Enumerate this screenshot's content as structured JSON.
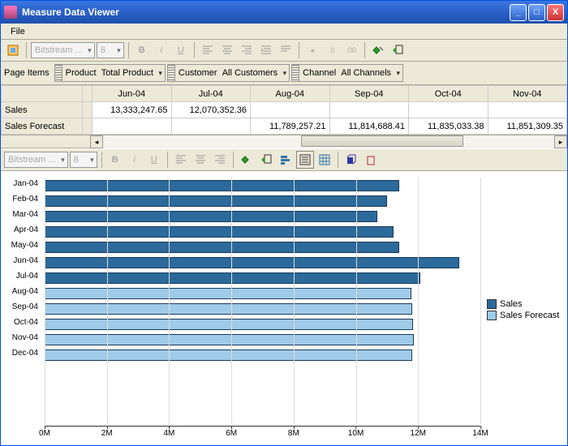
{
  "title": "Measure Data Viewer",
  "menu": {
    "file": "File"
  },
  "toolbar": {
    "font_name": "Bitstream ...",
    "font_size": "8"
  },
  "page_items": {
    "label": "Page Items",
    "dims": [
      {
        "name": "Product",
        "value": "Total Product"
      },
      {
        "name": "Customer",
        "value": "All Customers"
      },
      {
        "name": "Channel",
        "value": "All Channels"
      }
    ]
  },
  "grid": {
    "columns": [
      "Jun-04",
      "Jul-04",
      "Aug-04",
      "Sep-04",
      "Oct-04",
      "Nov-04"
    ],
    "rows": [
      {
        "label": "Sales",
        "cells": [
          "13,333,247.65",
          "12,070,352.36",
          "",
          "",
          "",
          ""
        ]
      },
      {
        "label": "Sales Forecast",
        "cells": [
          "",
          "",
          "11,789,257.21",
          "11,814,688.41",
          "11,835,033.38",
          "11,851,309.35"
        ]
      }
    ]
  },
  "legend": {
    "sales": "Sales",
    "forecast": "Sales Forecast"
  },
  "chart_data": {
    "type": "bar",
    "orientation": "horizontal",
    "categories": [
      "Jan-04",
      "Feb-04",
      "Mar-04",
      "Apr-04",
      "May-04",
      "Jun-04",
      "Jul-04",
      "Aug-04",
      "Sep-04",
      "Oct-04",
      "Nov-04",
      "Dec-04"
    ],
    "series": [
      {
        "name": "Sales",
        "values": [
          11400000,
          11000000,
          10700000,
          11200000,
          11400000,
          13333248,
          12070352,
          null,
          null,
          null,
          null,
          null
        ]
      },
      {
        "name": "Sales Forecast",
        "values": [
          null,
          null,
          null,
          null,
          null,
          null,
          null,
          11789257,
          11814688,
          11835033,
          11851309,
          11800000
        ]
      }
    ],
    "xlabel": "",
    "ylabel": "",
    "xlim": [
      0,
      14000000
    ],
    "xticks": [
      0,
      2000000,
      4000000,
      6000000,
      8000000,
      10000000,
      12000000,
      14000000
    ],
    "xtick_labels": [
      "0M",
      "2M",
      "4M",
      "6M",
      "8M",
      "10M",
      "12M",
      "14M"
    ]
  }
}
